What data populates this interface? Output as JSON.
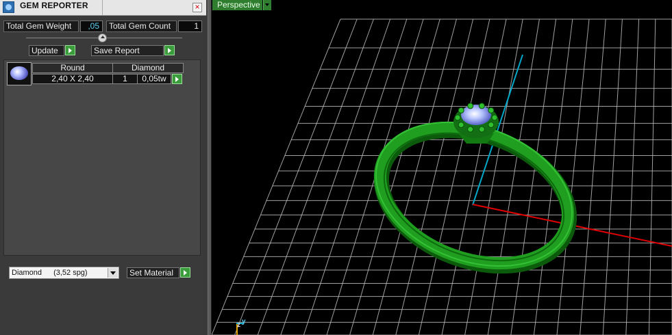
{
  "panel": {
    "title": "GEM REPORTER",
    "close_symbol": "×",
    "total_gem_weight_label": "Total Gem Weight",
    "total_gem_weight_value": ",05",
    "total_gem_count_label": "Total Gem Count",
    "total_gem_count_value": "1",
    "update_label": "Update",
    "save_report_label": "Save Report",
    "gems": [
      {
        "shape": "Round",
        "material": "Diamond",
        "size": "2,40 X 2,40",
        "count": "1",
        "weight": "0,05tw"
      }
    ],
    "material_select": {
      "material": "Diamond",
      "density": "(3,52 spg)"
    },
    "set_material_label": "Set Material"
  },
  "viewport": {
    "view_label": "Perspective",
    "axis_z": "z",
    "axis_y": "y"
  },
  "colors": {
    "panel_bg": "#3a3a3a",
    "accent_green": "#3a9c3a",
    "ring_green": "#1f9e1f",
    "grid": "#bdbdbd",
    "axis_x": "#e00000",
    "axis_y": "#00a8c8",
    "value_text": "#5fd0f0"
  },
  "icons": [
    "gem-reporter-app-icon",
    "close-icon",
    "slider-knob-icon",
    "go-arrow-icon",
    "round-diamond-thumbnail",
    "dropdown-arrow-icon",
    "axis-gizmo-icon"
  ]
}
